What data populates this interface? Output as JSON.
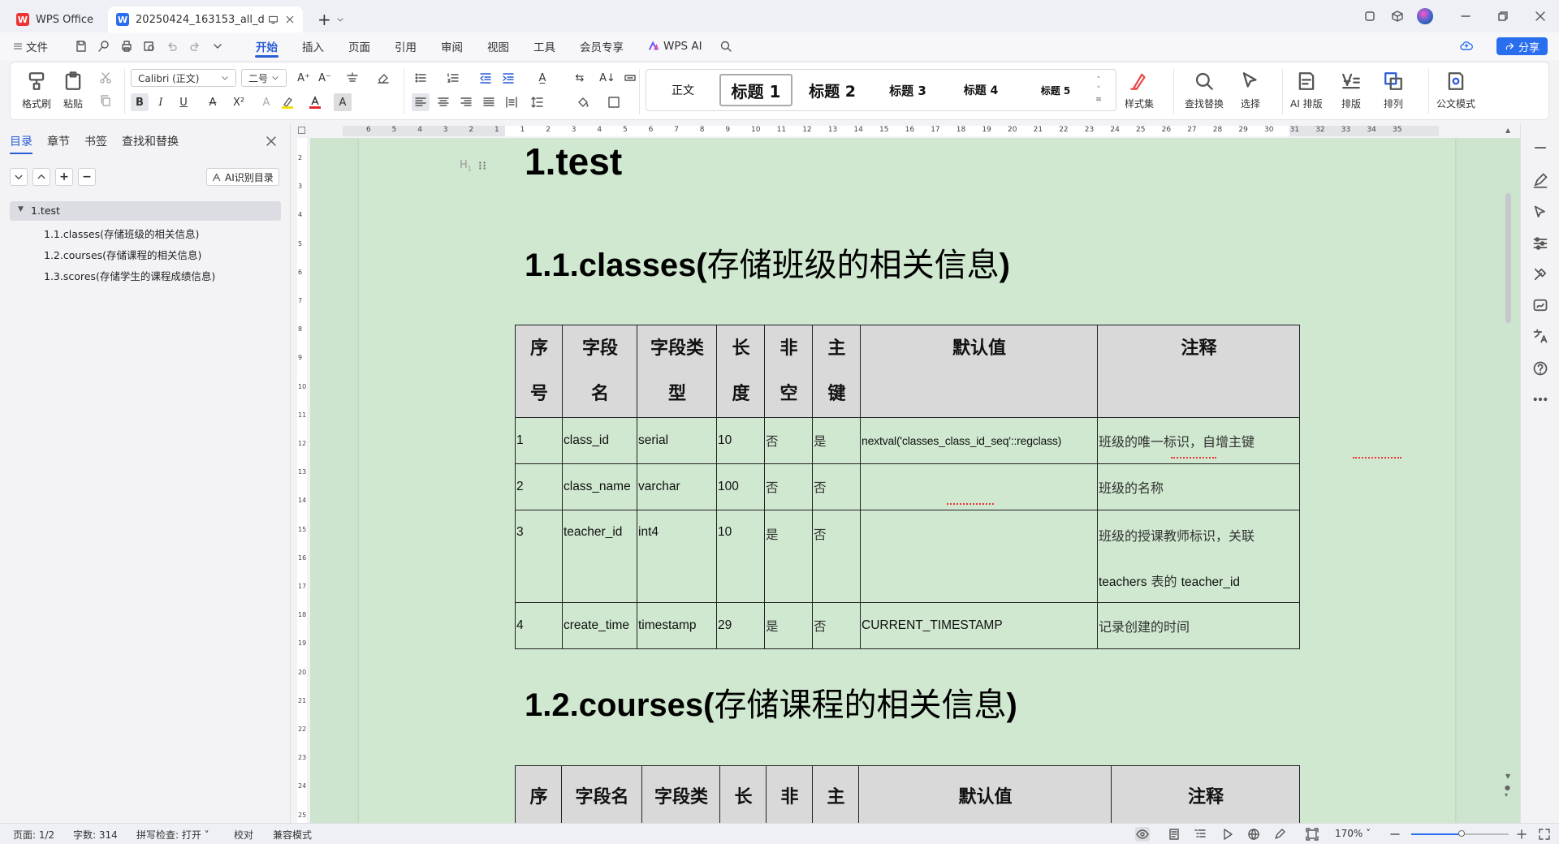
{
  "titlebar": {
    "app_tab": "WPS Office",
    "doc_tab": "20250424_163153_all_db.d",
    "new_tab": "+"
  },
  "menubar": {
    "file": "文件",
    "items": [
      "开始",
      "插入",
      "页面",
      "引用",
      "审阅",
      "视图",
      "工具",
      "会员专享"
    ],
    "active": "开始",
    "wps_ai": "WPS AI",
    "share": "分享"
  },
  "ribbon": {
    "format_painter": "格式刷",
    "paste": "粘贴",
    "font_name": "Calibri (正文)",
    "font_size": "二号",
    "styles": [
      "正文",
      "标题 1",
      "标题 2",
      "标题 3",
      "标题 4",
      "标题 5"
    ],
    "style_set": "样式集",
    "find_replace": "查找替换",
    "select": "选择",
    "ai_layout": "AI 排版",
    "layout": "排版",
    "arrange": "排列",
    "official_mode": "公文模式",
    "bold": "B",
    "italic": "I",
    "underline": "U"
  },
  "leftnav": {
    "tabs": [
      "目录",
      "章节",
      "书签",
      "查找和替换"
    ],
    "active_tab": "目录",
    "ai_toc": "AI识别目录",
    "toc": [
      "1.test",
      "1.1.classes(存储班级的相关信息)",
      "1.2.courses(存储课程的相关信息)",
      "1.3.scores(存储学生的课程成绩信息)"
    ]
  },
  "ruler": {
    "h_ticks": [
      "6",
      "5",
      "4",
      "3",
      "2",
      "1",
      "1",
      "2",
      "3",
      "4",
      "5",
      "6",
      "7",
      "8",
      "9",
      "10",
      "11",
      "12",
      "13",
      "14",
      "15",
      "16",
      "17",
      "18",
      "19",
      "20",
      "21",
      "22",
      "23",
      "24",
      "25",
      "26",
      "27",
      "28",
      "29",
      "30",
      "31",
      "32",
      "33",
      "34",
      "35"
    ],
    "v_ticks": [
      "2",
      "3",
      "4",
      "5",
      "6",
      "7",
      "8",
      "9",
      "10",
      "11",
      "12",
      "13",
      "14",
      "15",
      "16",
      "17",
      "18",
      "19",
      "20",
      "21",
      "22",
      "23",
      "24",
      "25"
    ]
  },
  "document": {
    "heading_mark": "H",
    "h1": "1.test",
    "h2_1_prefix": "1.1.classes(",
    "h2_1_cn": "存储班级的相关信息",
    "h2_1_suffix": ")",
    "h2_2_prefix": "1.2.courses(",
    "h2_2_cn": "存储课程的相关信息",
    "h2_2_suffix": ")",
    "table1": {
      "headers": [
        [
          "序",
          "号"
        ],
        [
          "字段",
          "名"
        ],
        [
          "字段类",
          "型"
        ],
        [
          "长",
          "度"
        ],
        [
          "非",
          "空"
        ],
        [
          "主",
          "键"
        ],
        [
          "默认值",
          ""
        ],
        [
          "注释",
          ""
        ]
      ],
      "rows": [
        [
          "1",
          "class_id",
          "serial",
          "10",
          "否",
          "是",
          "nextval('classes_class_id_seq'::regclass)",
          "班级的唯一标识，自增主键"
        ],
        [
          "2",
          "class_name",
          "varchar",
          "100",
          "否",
          "否",
          "",
          "班级的名称"
        ],
        [
          "3",
          "teacher_id",
          "int4",
          "10",
          "是",
          "否",
          "",
          "班级的授课教师标识，关联"
        ],
        [
          "4",
          "create_time",
          "timestamp",
          "29",
          "是",
          "否",
          "CURRENT_TIMESTAMP",
          "记录创建的时间"
        ]
      ],
      "row3_note_line2_a": "teachers",
      "row3_note_line2_b": " 表的 ",
      "row3_note_line2_c": "teacher_id"
    },
    "table2": {
      "headers": [
        "序",
        "字段名",
        "字段类",
        "长",
        "非",
        "主",
        "默认值",
        "注释"
      ]
    }
  },
  "statusbar": {
    "page": "页面: 1/2",
    "words": "字数: 314",
    "spell": "拼写检查: 打开",
    "proof": "校对",
    "compat": "兼容模式",
    "zoom": "170%"
  }
}
